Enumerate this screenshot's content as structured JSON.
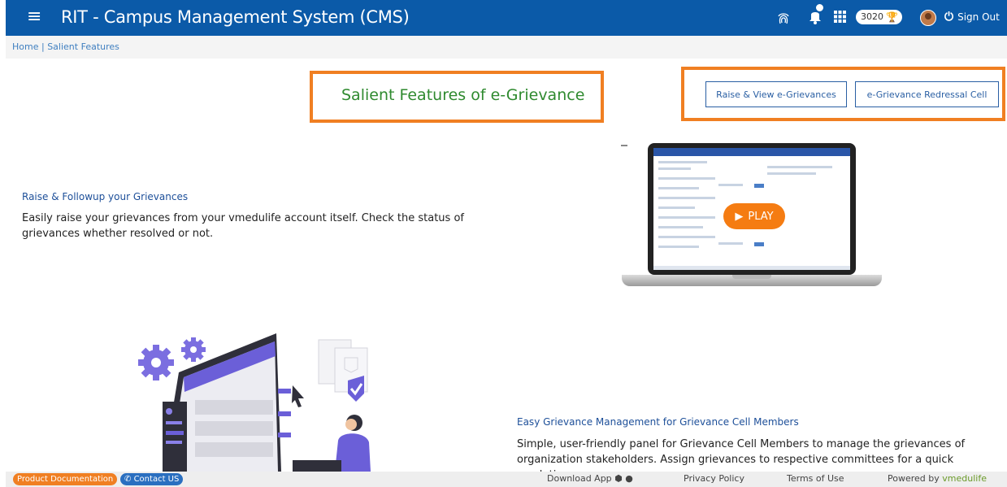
{
  "header": {
    "title": "RIT - Campus Management System (CMS)",
    "points": "3020",
    "sign_out": "Sign Out",
    "icons": [
      "menu-icon",
      "fingerprint-icon",
      "bell-icon",
      "apps-grid-icon",
      "trophy-icon",
      "power-icon"
    ],
    "accent_color": "#0b5aa8"
  },
  "breadcrumb": {
    "home": "Home",
    "separator": "|",
    "current": "Salient Features"
  },
  "main": {
    "page_title": "Salient Features of e-Grievance",
    "buttons": {
      "raise_view": "Raise & View e-Grievances",
      "redressal_cell": "e-Grievance Redressal Cell"
    },
    "highlight_color": "#f07f22",
    "video": {
      "play_label": "PLAY"
    },
    "features": [
      {
        "heading": "Raise & Followup your Grievances",
        "text": "Easily raise your grievances from your vmedulife account itself. Check the status of grievances whether resolved or not."
      },
      {
        "heading": "Easy Grievance Management for Grievance Cell Members",
        "text": "Simple, user-friendly panel for Grievance Cell Members to manage the grievances of organization stakeholders. Assign grievances to respective committees for a quick resolution."
      }
    ]
  },
  "footer": {
    "product_docs": "Product Documentation",
    "contact": "Contact US",
    "download_app": "Download App",
    "privacy": "Privacy Policy",
    "terms": "Terms of Use",
    "powered_by": "Powered by",
    "brand": "vmedulife"
  }
}
